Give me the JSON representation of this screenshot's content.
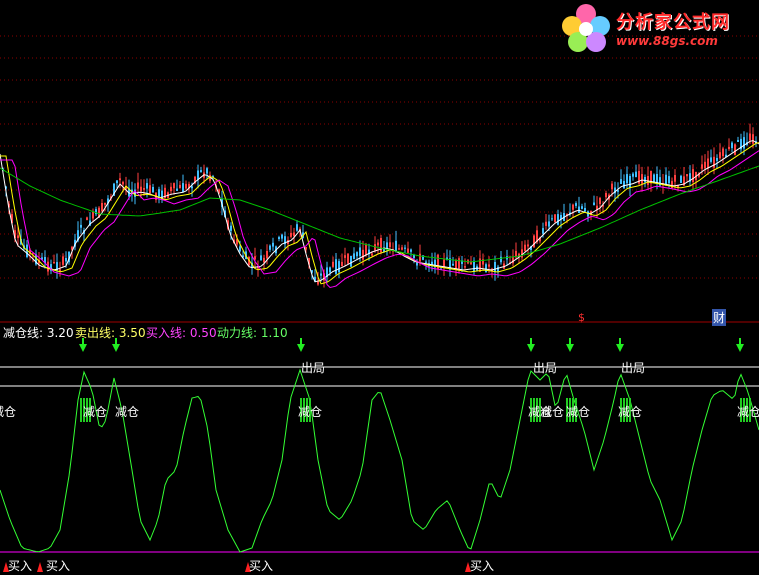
{
  "logo": {
    "title": "分析家公式网",
    "url": "www.88gs.com"
  },
  "main_chart": {
    "markers": {
      "s": "$",
      "cai": "财"
    }
  },
  "indicator_header": [
    {
      "label": "减仓线: 3.20",
      "color": "#ffffff"
    },
    {
      "label": "卖出线: 3.50",
      "color": "#ffff66"
    },
    {
      "label": "买入线: 0.50",
      "color": "#ff44ff"
    },
    {
      "label": "动力线: 1.10",
      "color": "#66ff66"
    }
  ],
  "signals": {
    "chuju": "出局",
    "jiancang": "减仓",
    "mairu": "买入"
  },
  "colors": {
    "background": "#000000",
    "candle_up": "#ff4040",
    "candle_down": "#40c0ff",
    "ma_short": "#ffffff",
    "ma_mid": "#ffff00",
    "ma_long": "#ff00ff",
    "ma_trend": "#00c000",
    "oscillator": "#33ff33",
    "sell_level": "#ffffff",
    "buy_level": "#ff00ff",
    "grid": "#8b0000"
  }
}
